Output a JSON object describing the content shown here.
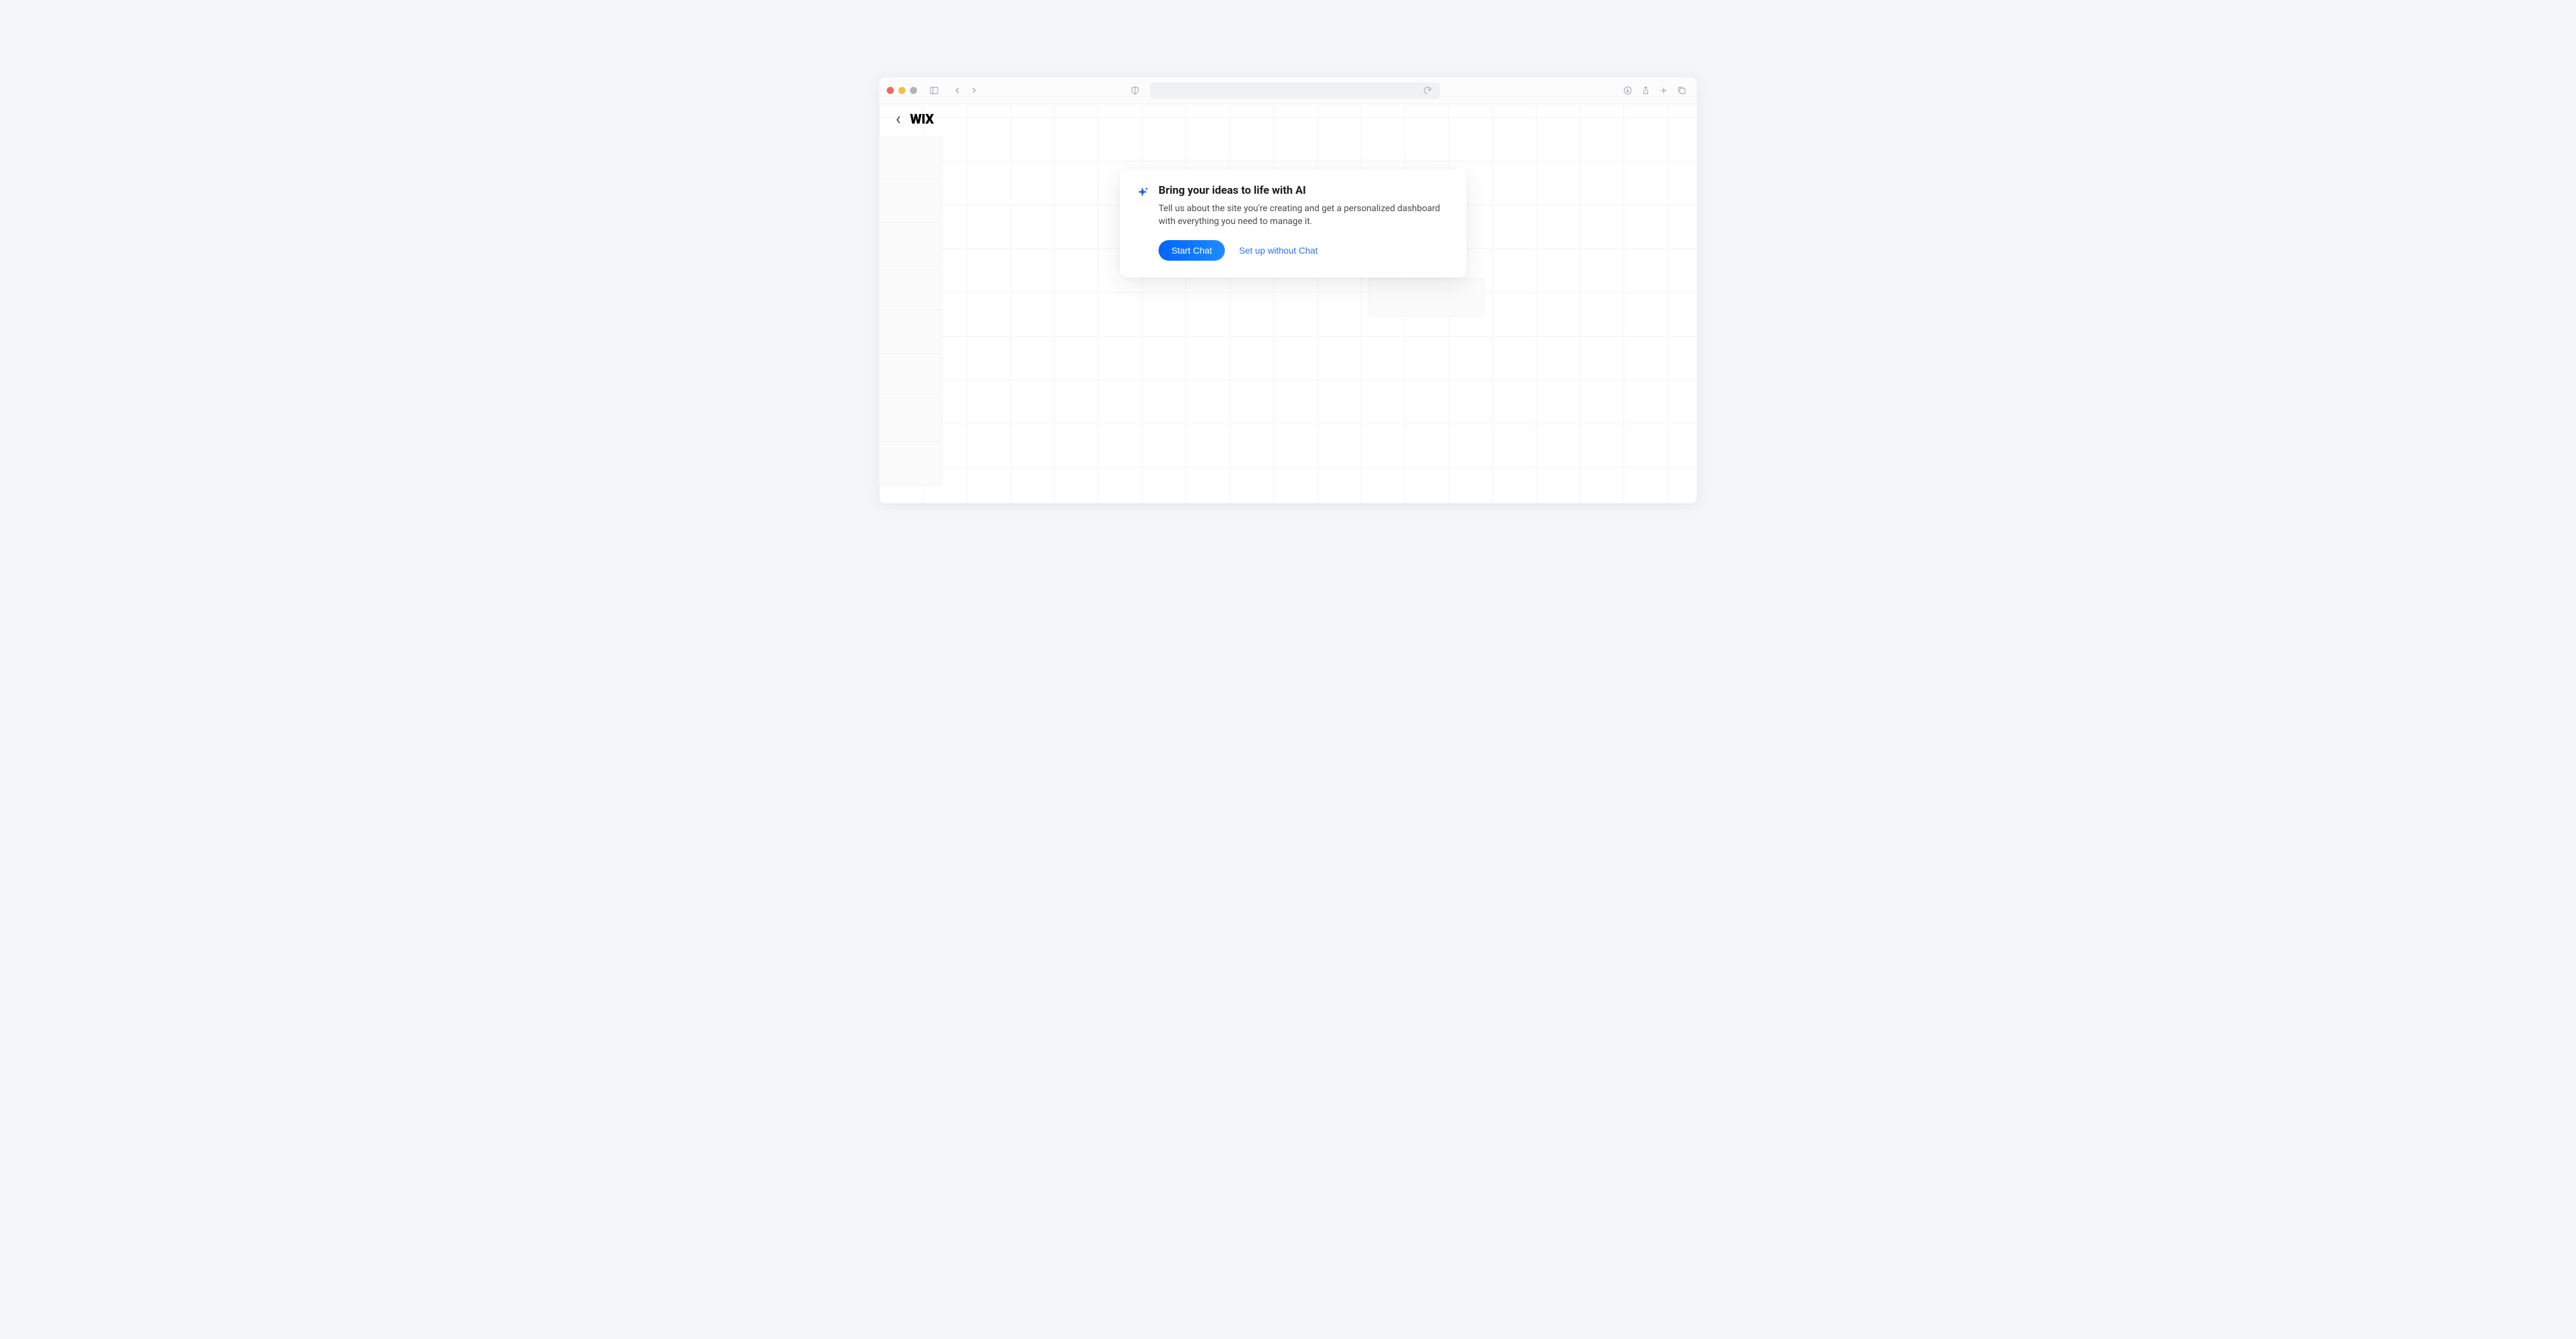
{
  "app": {
    "logo_text": "WIX"
  },
  "ai_card": {
    "title": "Bring your ideas to life with AI",
    "description": "Tell us about the site you're creating and get a personalized dashboard with everything you need to manage it.",
    "primary_button_label": "Start Chat",
    "secondary_button_label": "Set up without Chat"
  }
}
